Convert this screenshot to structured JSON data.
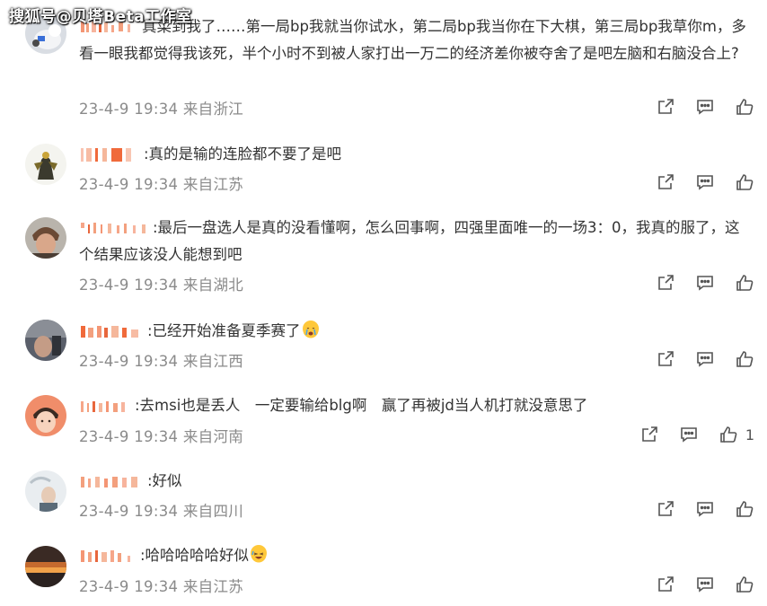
{
  "watermark": "搜狐号@贝塔Beta工作室",
  "comments": [
    {
      "text": "真菜到我了……第一局bp我就当你试水，第二局bp我当你在下大棋，第三局bp我草你m，多看一眼我都觉得我该死，半个小时不到被人家打出一万二的经济差你被夺舍了是吧左脑和右脑没合上?",
      "meta": "23-4-9 19:34 来自浙江",
      "likes": ""
    },
    {
      "text": ":真的是输的连脸都不要了是吧",
      "meta": "23-4-9 19:34 来自江苏",
      "likes": ""
    },
    {
      "text": ":最后一盘选人是真的没看懂啊，怎么回事啊，四强里面唯一的一场3：0，我真的服了，这个结果应该没人能想到吧",
      "meta": "23-4-9 19:34 来自湖北",
      "likes": ""
    },
    {
      "text": ":已经开始准备夏季赛了",
      "meta": "23-4-9 19:34 来自江西",
      "likes": ""
    },
    {
      "text": ":去msi也是丢人　一定要输给blg啊　赢了再被jd当人机打就没意思了",
      "meta": "23-4-9 19:34 来自河南",
      "likes": "1"
    },
    {
      "text": ":好似",
      "meta": "23-4-9 19:34 来自四川",
      "likes": ""
    },
    {
      "text": ":哈哈哈哈哈好似",
      "meta": "23-4-9 19:34 来自江苏",
      "likes": ""
    }
  ],
  "icons": {
    "share": "share-icon",
    "comment": "comment-icon",
    "like": "thumbs-up-icon"
  },
  "colors": {
    "text": "#333333",
    "meta": "#8a8a8a",
    "name_mark": "#f06a3b"
  }
}
